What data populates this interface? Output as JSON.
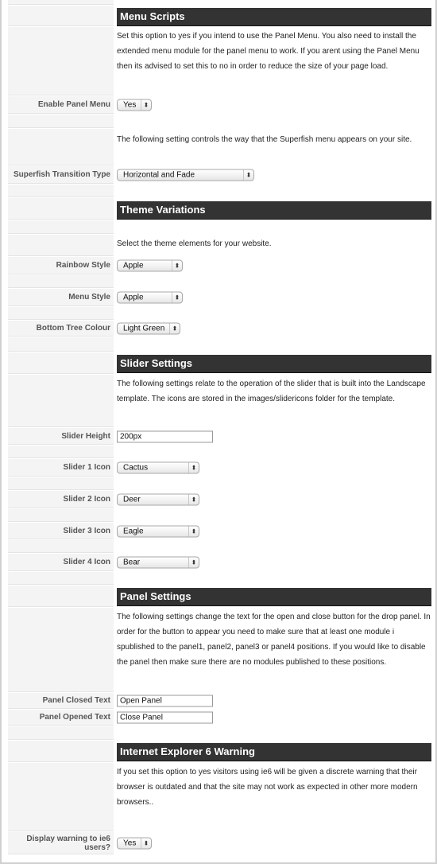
{
  "sections": {
    "menu_scripts": {
      "title": "Menu Scripts",
      "description": "Set this option to yes if you intend to use the Panel Menu. You also need to install the extended menu module for the panel menu to work. If you arent using the Panel Menu then its advised to set this to no in order to reduce the size of your page load.",
      "enable_panel_menu": {
        "label": "Enable Panel Menu",
        "value": "Yes"
      },
      "superfish_description": "The following setting controls the way that the Superfish menu appears on your site.",
      "superfish_transition": {
        "label": "Superfish Transition Type",
        "value": "Horizontal and Fade"
      }
    },
    "theme_variations": {
      "title": "Theme Variations",
      "description": "Select the theme elements for your website.",
      "rainbow_style": {
        "label": "Rainbow Style",
        "value": "Apple"
      },
      "menu_style": {
        "label": "Menu Style",
        "value": "Apple"
      },
      "bottom_tree_colour": {
        "label": "Bottom Tree Colour",
        "value": "Light Green"
      }
    },
    "slider_settings": {
      "title": "Slider Settings",
      "description": "The following settings relate to the operation of the slider that is built into the Landscape template. The icons are stored in the images/slidericons folder for the template.",
      "slider_height": {
        "label": "Slider Height",
        "value": "200px"
      },
      "slider_1_icon": {
        "label": "Slider 1 Icon",
        "value": "Cactus"
      },
      "slider_2_icon": {
        "label": "Slider 2 Icon",
        "value": "Deer"
      },
      "slider_3_icon": {
        "label": "Slider 3 Icon",
        "value": "Eagle"
      },
      "slider_4_icon": {
        "label": "Slider 4 Icon",
        "value": "Bear"
      }
    },
    "panel_settings": {
      "title": "Panel Settings",
      "description": "The following settings change the text for the open and close button for the drop panel. In order for the button to appear you need to make sure that at least one module i spublished to the panel1, panel2, panel3 or panel4 positions. If you would like to disable the panel then make sure there are no modules published to these positions.",
      "panel_closed_text": {
        "label": "Panel Closed Text",
        "value": "Open Panel"
      },
      "panel_opened_text": {
        "label": "Panel Opened Text",
        "value": "Close Panel"
      }
    },
    "ie6_warning": {
      "title": "Internet Explorer 6 Warning",
      "description": "If you set this option to yes visitors using ie6 will be given a discrete warning that their browser is outdated and that the site may not work as expected in other more modern browsers..",
      "display_warning": {
        "label": "Display warning to ie6 users?",
        "value": "Yes"
      }
    }
  },
  "icons": {
    "select_arrow": "⬍"
  }
}
